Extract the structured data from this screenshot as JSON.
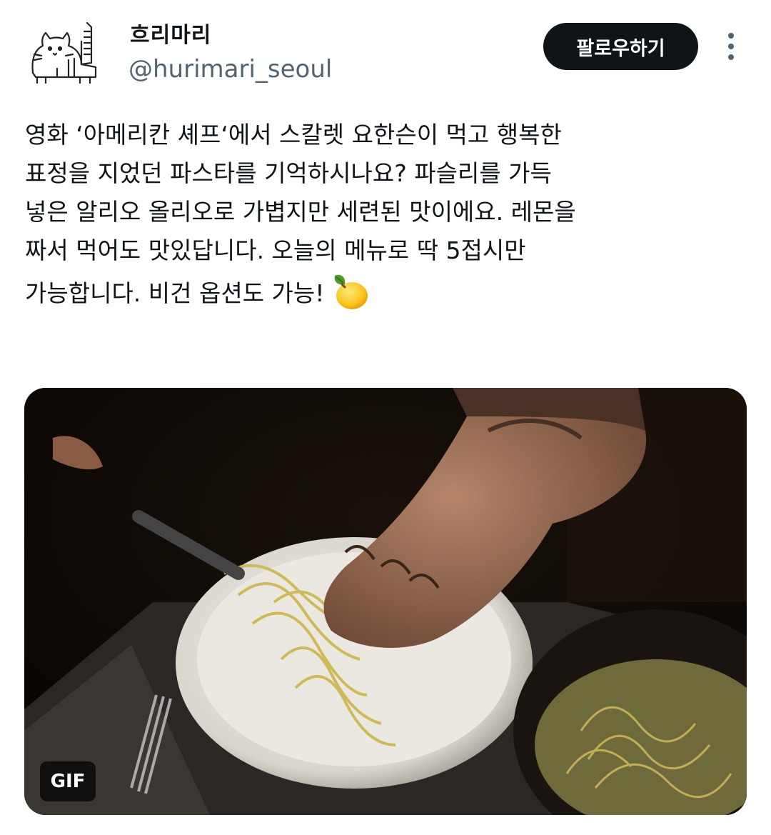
{
  "account": {
    "display_name": "흐리마리",
    "handle": "@hurimari_seoul",
    "avatar_icon": "cat-doodle-avatar"
  },
  "actions": {
    "follow_label": "팔로우하기",
    "more_icon": "more-vertical-icon"
  },
  "tweet": {
    "text": "영화 ‘아메리칸 셰프‘에서 스칼렛 요한슨이 먹고 행복한\n표정을 지었던 파스타를 기억하시나요? 파슬리를 가득\n넣은 알리오 올리오로 가볍지만 세련된 맛이에요. 레몬을\n짜서 먹어도 맛있답니다. 오늘의 메뉴로 딱 5접시만\n가능합니다. 비건 옵션도 가능!",
    "emoji": "lemon-icon"
  },
  "media": {
    "type": "GIF",
    "badge": "GIF"
  },
  "colors": {
    "text": "#0f1419",
    "secondary": "#536471",
    "button_bg": "#0f1419",
    "button_text": "#ffffff"
  }
}
